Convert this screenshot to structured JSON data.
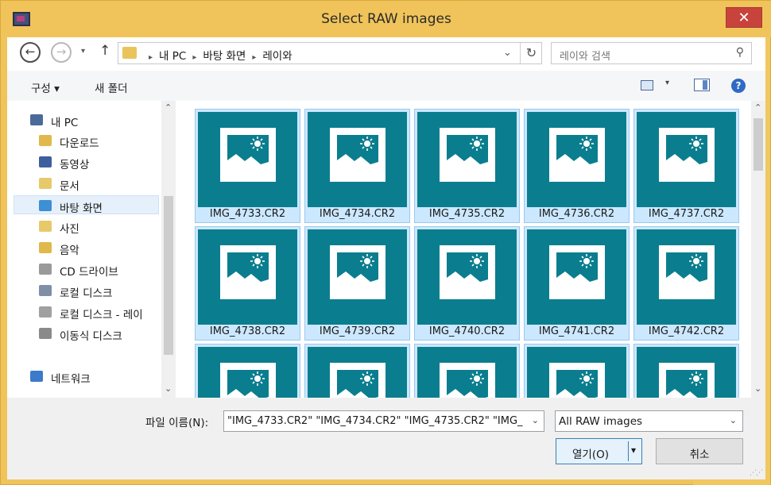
{
  "window": {
    "title": "Select RAW images",
    "close_glyph": "✕",
    "colors": {
      "frame": "#f0c45a",
      "close": "#c7433b",
      "tile_bg": "#0a7e8f",
      "selection": "#cce8ff"
    }
  },
  "nav": {
    "back_glyph": "←",
    "forward_glyph": "→",
    "recent_glyph": "▾",
    "up_glyph": "↑"
  },
  "address": {
    "crumbs": [
      "내 PC",
      "바탕 화면",
      "레이와"
    ],
    "separator": "▸",
    "dropdown_glyph": "⌄",
    "refresh_glyph": "↻"
  },
  "search": {
    "placeholder": "레이와 검색",
    "icon": "search-icon",
    "glyph": "⚲"
  },
  "toolbar": {
    "organize_label": "구성 ▾",
    "new_folder_label": "새 폴더",
    "view_dd_glyph": "▾",
    "help_glyph": "?"
  },
  "tree": {
    "up_glyph": "⌃",
    "down_glyph": "⌄",
    "items": [
      {
        "label": "내 PC",
        "icon": "computer-icon",
        "color": "#4a6a9a",
        "indent": 0,
        "selected": false
      },
      {
        "label": "다운로드",
        "icon": "downloads-icon",
        "color": "#e0b84b",
        "indent": 1,
        "selected": false
      },
      {
        "label": "동영상",
        "icon": "videos-icon",
        "color": "#3d5f9e",
        "indent": 1,
        "selected": false
      },
      {
        "label": "문서",
        "icon": "documents-icon",
        "color": "#e8c96a",
        "indent": 1,
        "selected": false
      },
      {
        "label": "바탕 화면",
        "icon": "desktop-icon",
        "color": "#3d8fd6",
        "indent": 1,
        "selected": true
      },
      {
        "label": "사진",
        "icon": "pictures-icon",
        "color": "#e8c96a",
        "indent": 1,
        "selected": false
      },
      {
        "label": "음악",
        "icon": "music-icon",
        "color": "#e0b84b",
        "indent": 1,
        "selected": false
      },
      {
        "label": "CD 드라이브",
        "icon": "cd-drive-icon",
        "color": "#9a9a9a",
        "indent": 1,
        "selected": false
      },
      {
        "label": "로컬 디스크",
        "icon": "local-disk-icon",
        "color": "#7f8fa6",
        "indent": 1,
        "selected": false
      },
      {
        "label": "로컬 디스크 - 레이",
        "icon": "local-disk-icon",
        "color": "#a0a0a0",
        "indent": 1,
        "selected": false
      },
      {
        "label": "이동식 디스크",
        "icon": "removable-disk-icon",
        "color": "#8a8a8a",
        "indent": 1,
        "selected": false
      },
      {
        "label": "네트워크",
        "icon": "network-icon",
        "color": "#3b7bc9",
        "indent": 0,
        "selected": false
      }
    ]
  },
  "files": {
    "up_glyph": "⌃",
    "down_glyph": "⌄",
    "items": [
      "IMG_4733.CR2",
      "IMG_4734.CR2",
      "IMG_4735.CR2",
      "IMG_4736.CR2",
      "IMG_4737.CR2",
      "IMG_4738.CR2",
      "IMG_4739.CR2",
      "IMG_4740.CR2",
      "IMG_4741.CR2",
      "IMG_4742.CR2",
      "",
      "",
      "",
      "",
      ""
    ]
  },
  "bottom": {
    "filename_label": "파일 이름(N):",
    "filename_value": "\"IMG_4733.CR2\" \"IMG_4734.CR2\" \"IMG_4735.CR2\" \"IMG_",
    "filename_dd": "⌄",
    "filetype_value": "All RAW images",
    "filetype_dd": "⌄",
    "open_label": "열기(O)",
    "open_split_glyph": "▾",
    "cancel_label": "취소",
    "grip_glyph": "⋰⋰"
  }
}
